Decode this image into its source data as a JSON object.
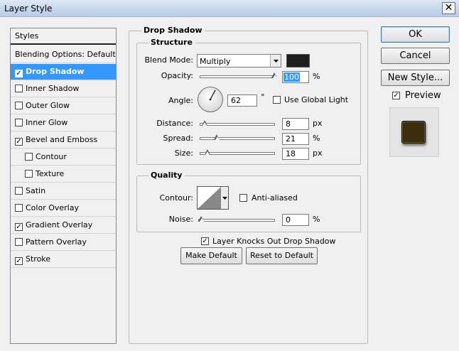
{
  "window": {
    "title": "Layer Style",
    "close_glyph": "✕"
  },
  "styles": {
    "header": "Styles",
    "blending_options": "Blending Options: Default",
    "items": [
      {
        "label": "Drop Shadow",
        "checked": true,
        "selected": true,
        "indent": false
      },
      {
        "label": "Inner Shadow",
        "checked": false,
        "selected": false,
        "indent": false
      },
      {
        "label": "Outer Glow",
        "checked": false,
        "selected": false,
        "indent": false
      },
      {
        "label": "Inner Glow",
        "checked": false,
        "selected": false,
        "indent": false
      },
      {
        "label": "Bevel and Emboss",
        "checked": true,
        "selected": false,
        "indent": false
      },
      {
        "label": "Contour",
        "checked": false,
        "selected": false,
        "indent": true
      },
      {
        "label": "Texture",
        "checked": false,
        "selected": false,
        "indent": true
      },
      {
        "label": "Satin",
        "checked": false,
        "selected": false,
        "indent": false
      },
      {
        "label": "Color Overlay",
        "checked": false,
        "selected": false,
        "indent": false
      },
      {
        "label": "Gradient Overlay",
        "checked": true,
        "selected": false,
        "indent": false
      },
      {
        "label": "Pattern Overlay",
        "checked": false,
        "selected": false,
        "indent": false
      },
      {
        "label": "Stroke",
        "checked": true,
        "selected": false,
        "indent": false
      }
    ]
  },
  "drop_shadow": {
    "title": "Drop Shadow",
    "structure": {
      "title": "Structure",
      "blend_mode_label": "Blend Mode:",
      "blend_mode_value": "Multiply",
      "shadow_color": "#1e1e1e",
      "opacity_label": "Opacity:",
      "opacity_value": "100",
      "opacity_level": 1.0,
      "percent": "%",
      "angle_label": "Angle:",
      "angle_value": "62",
      "angle_degrees": 62,
      "degree_symbol": "°",
      "use_global_light_label": "Use Global Light",
      "use_global_light_checked": false,
      "distance_label": "Distance:",
      "distance_value": "8",
      "distance_level": 0.03,
      "spread_label": "Spread:",
      "spread_value": "21",
      "spread_level": 0.21,
      "size_label": "Size:",
      "size_value": "18",
      "size_level": 0.07,
      "px": "px"
    },
    "quality": {
      "title": "Quality",
      "contour_label": "Contour:",
      "anti_aliased_label": "Anti-aliased",
      "anti_aliased_checked": false,
      "noise_label": "Noise:",
      "noise_value": "0",
      "noise_level": 0
    },
    "layer_knocks_out_label": "Layer Knocks Out Drop Shadow",
    "layer_knocks_out_checked": true,
    "make_default_label": "Make Default",
    "reset_to_default_label": "Reset to Default"
  },
  "actions": {
    "ok_label": "OK",
    "cancel_label": "Cancel",
    "new_style_label": "New Style...",
    "preview_label": "Preview",
    "preview_checked": true,
    "preview_swatch_color": "#3b2e0c"
  }
}
